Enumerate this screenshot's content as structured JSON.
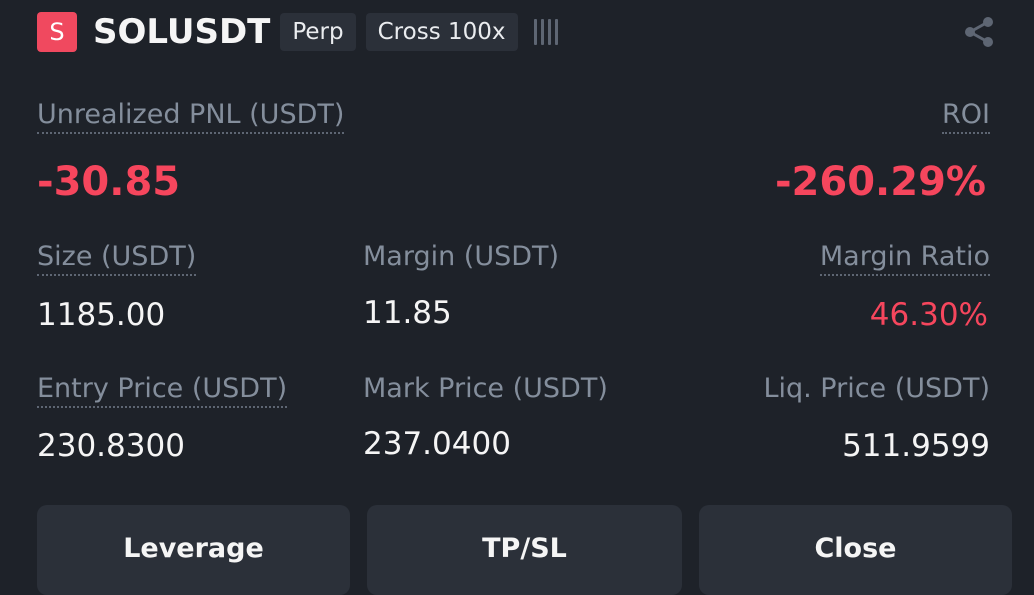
{
  "header": {
    "side_badge": "S",
    "symbol": "SOLUSDT",
    "tag_type": "Perp",
    "tag_margin": "Cross 100x"
  },
  "pnl": {
    "label": "Unrealized PNL (USDT)",
    "value": "-30.85"
  },
  "roi": {
    "label": "ROI",
    "value": "-260.29%"
  },
  "size": {
    "label": "Size (USDT)",
    "value": "1185.00"
  },
  "margin": {
    "label": "Margin (USDT)",
    "value": "11.85"
  },
  "margin_ratio": {
    "label": "Margin Ratio",
    "value": "46.30%"
  },
  "entry_price": {
    "label": "Entry Price (USDT)",
    "value": "230.8300"
  },
  "mark_price": {
    "label": "Mark Price (USDT)",
    "value": "237.0400"
  },
  "liq_price": {
    "label": "Liq. Price (USDT)",
    "value": "511.9599"
  },
  "buttons": {
    "leverage": "Leverage",
    "tpsl": "TP/SL",
    "close": "Close"
  },
  "icons": {
    "share": "share-icon",
    "bars": "bars-icon"
  },
  "colors": {
    "background": "#1e2229",
    "negative": "#f6465d",
    "badge": "#f0495f",
    "label": "#848e9c",
    "button": "#2b3039"
  }
}
